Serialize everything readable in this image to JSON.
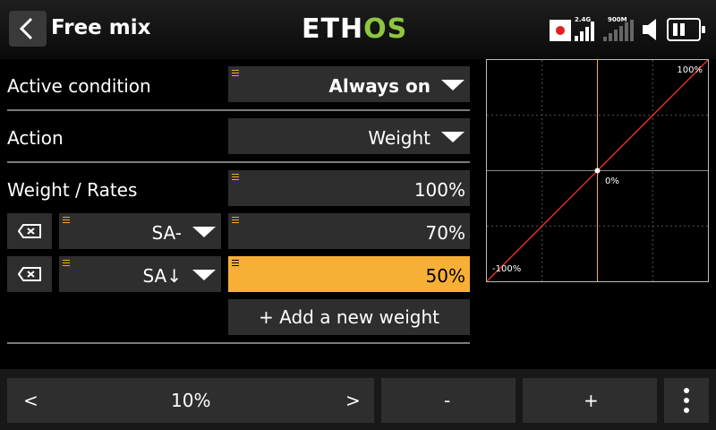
{
  "header": {
    "title": "Free mix",
    "logo_left": "ETH",
    "logo_right": "OS",
    "radio_label_1": "2.4G",
    "radio_label_2": "900M"
  },
  "rows": {
    "active_condition": {
      "label": "Active condition",
      "value": "Always on"
    },
    "action": {
      "label": "Action",
      "value": "Weight"
    },
    "weight_rates": {
      "label": "Weight / Rates",
      "value": "100%"
    },
    "rate_rows": [
      {
        "source": "SA-",
        "weight": "70%"
      },
      {
        "source": "SA↓",
        "weight": "50%"
      }
    ],
    "add_weight": "+ Add a new weight"
  },
  "curve": {
    "top_label": "100%",
    "center_label": "0%",
    "bottom_label": "-100%",
    "colors": {
      "line": "#e03020",
      "cursor": "#f7b035",
      "grid": "#555555"
    }
  },
  "bottom": {
    "prev": "<",
    "step_value": "10%",
    "next": ">",
    "minus": "-",
    "plus": "+"
  },
  "colors": {
    "accent": "#f7b035",
    "logo_green": "#8dc63f"
  }
}
